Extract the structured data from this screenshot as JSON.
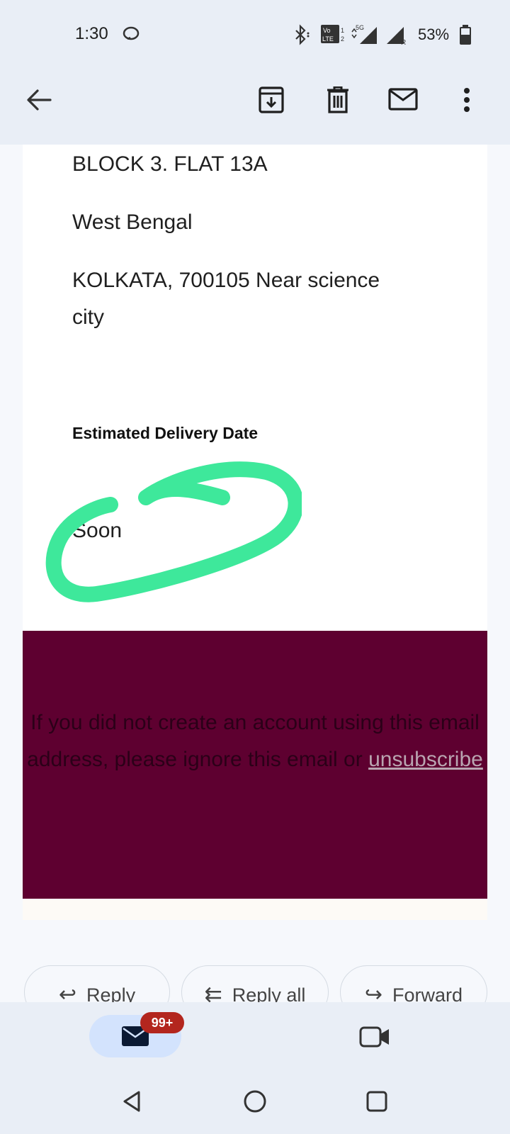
{
  "status_bar": {
    "time": "1:30",
    "battery": "53%",
    "icons": [
      "messenger-icon",
      "bluetooth-icon",
      "volte-icon",
      "5g-signal-icon",
      "signal-roaming-icon",
      "battery-icon"
    ]
  },
  "app_bar": {
    "icons": [
      "back-arrow-icon",
      "archive-icon",
      "delete-icon",
      "mark-unread-icon",
      "more-vert-icon"
    ]
  },
  "email": {
    "address_lines": [
      "BLOCK 3. FLAT 13A",
      "West Bengal",
      "KOLKATA, 700105 Near science",
      "city"
    ],
    "delivery_heading": "Estimated Delivery Date",
    "delivery_value": "Soon",
    "footer_text": "If you did not create an account using this email address, please ignore this email or",
    "footer_link": "unsubscribe",
    "highlight_color": "#3ee89b",
    "footer_bg": "#5e0030"
  },
  "actions": {
    "reply": "Reply",
    "reply_all": "Reply all",
    "forward": "Forward"
  },
  "bottom_nav": {
    "mail_badge": "99+",
    "items": [
      "mail-icon",
      "meet-video-icon"
    ]
  },
  "system_nav": [
    "back-triangle-icon",
    "home-circle-icon",
    "recents-square-icon"
  ]
}
